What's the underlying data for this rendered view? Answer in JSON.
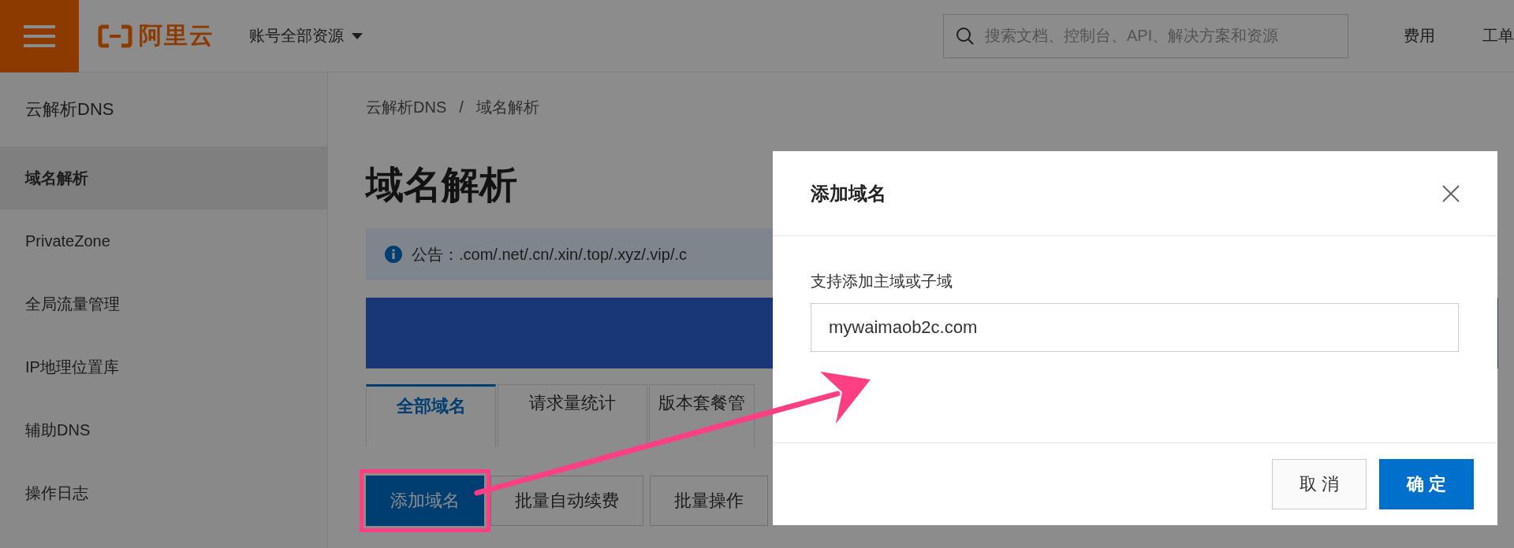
{
  "topbar": {
    "brand": "阿里云",
    "account_menu": "账号全部资源",
    "search": {
      "placeholder": "搜索文档、控制台、API、解决方案和资源"
    },
    "links": [
      "费用",
      "工单"
    ]
  },
  "sidebar": {
    "title": "云解析DNS",
    "items": [
      {
        "label": "域名解析",
        "selected": true
      },
      {
        "label": "PrivateZone",
        "selected": false
      },
      {
        "label": "全局流量管理",
        "selected": false
      },
      {
        "label": "IP地理位置库",
        "selected": false
      },
      {
        "label": "辅助DNS",
        "selected": false
      },
      {
        "label": "操作日志",
        "selected": false
      }
    ]
  },
  "breadcrumb": [
    "云解析DNS",
    "域名解析"
  ],
  "breadcrumb_separator": "/",
  "page_title": "域名解析",
  "notice": {
    "label": "公告：",
    "text": ".com/.net/.cn/.xin/.top/.xyz/.vip/.c"
  },
  "banner": {
    "kind": "promo"
  },
  "tabs": [
    {
      "label": "全部域名",
      "selected": true
    },
    {
      "label": "请求量统计",
      "selected": false
    },
    {
      "label": "版本套餐管",
      "selected": false
    }
  ],
  "actions": [
    {
      "label": "添加域名",
      "kind": "primary",
      "highlighted": true
    },
    {
      "label": "批量自动续费",
      "kind": "default",
      "highlighted": false
    },
    {
      "label": "批量操作",
      "kind": "default",
      "highlighted": false
    }
  ],
  "modal": {
    "title": "添加域名",
    "field_label": "支持添加主域或子域",
    "field_value": "mywaimaob2c.com",
    "buttons": [
      {
        "label": "取 消",
        "kind": "default"
      },
      {
        "label": "确 定",
        "kind": "primary"
      }
    ]
  }
}
